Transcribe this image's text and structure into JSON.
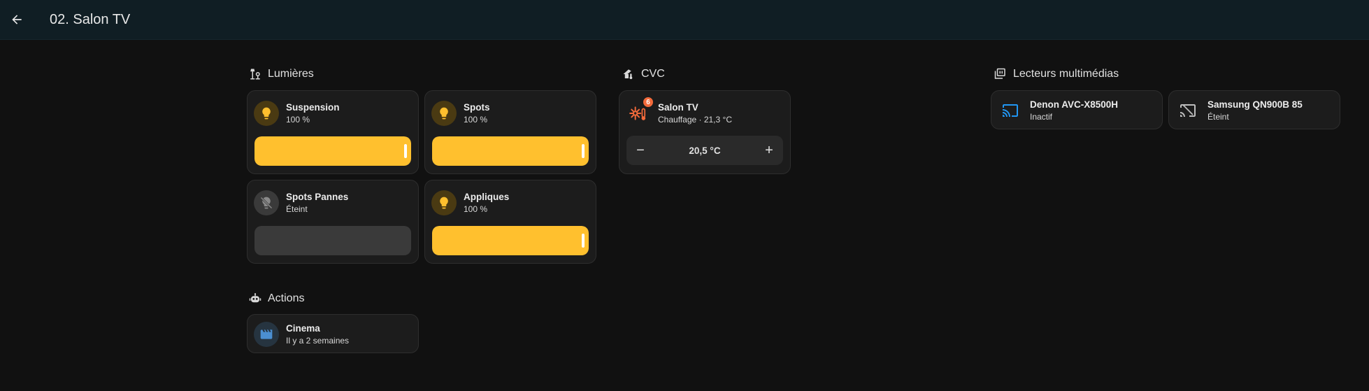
{
  "header": {
    "title": "02. Salon TV"
  },
  "sections": {
    "lights": {
      "title": "Lumières"
    },
    "climate": {
      "title": "CVC"
    },
    "media": {
      "title": "Lecteurs multimédias"
    },
    "actions": {
      "title": "Actions"
    }
  },
  "lights": [
    {
      "name": "Suspension",
      "state": "100 %",
      "on": true,
      "brightness_percent": 100
    },
    {
      "name": "Spots",
      "state": "100 %",
      "on": true,
      "brightness_percent": 100
    },
    {
      "name": "Spots Pannes",
      "state": "Éteint",
      "on": false,
      "brightness_percent": 0
    },
    {
      "name": "Appliques",
      "state": "100 %",
      "on": true,
      "brightness_percent": 100
    }
  ],
  "climate": {
    "name": "Salon TV",
    "state": "Chauffage · 21,3 °C",
    "badge": "6",
    "target": "20,5 °C",
    "minus": "−",
    "plus": "+"
  },
  "media": [
    {
      "name": "Denon AVC-X8500H",
      "state": "Inactif",
      "icon": "cast-icon"
    },
    {
      "name": "Samsung QN900B 85",
      "state": "Éteint",
      "icon": "cast-off-icon"
    }
  ],
  "actions": [
    {
      "name": "Cinema",
      "state": "Il y a 2 semaines",
      "icon": "clapperboard-icon"
    }
  ],
  "colors": {
    "accent_light": "#ffc02e",
    "accent_heat": "#f36a3b",
    "accent_media": "#2196f3",
    "background": "#111111",
    "header": "#101e24",
    "card": "#1c1c1c"
  }
}
